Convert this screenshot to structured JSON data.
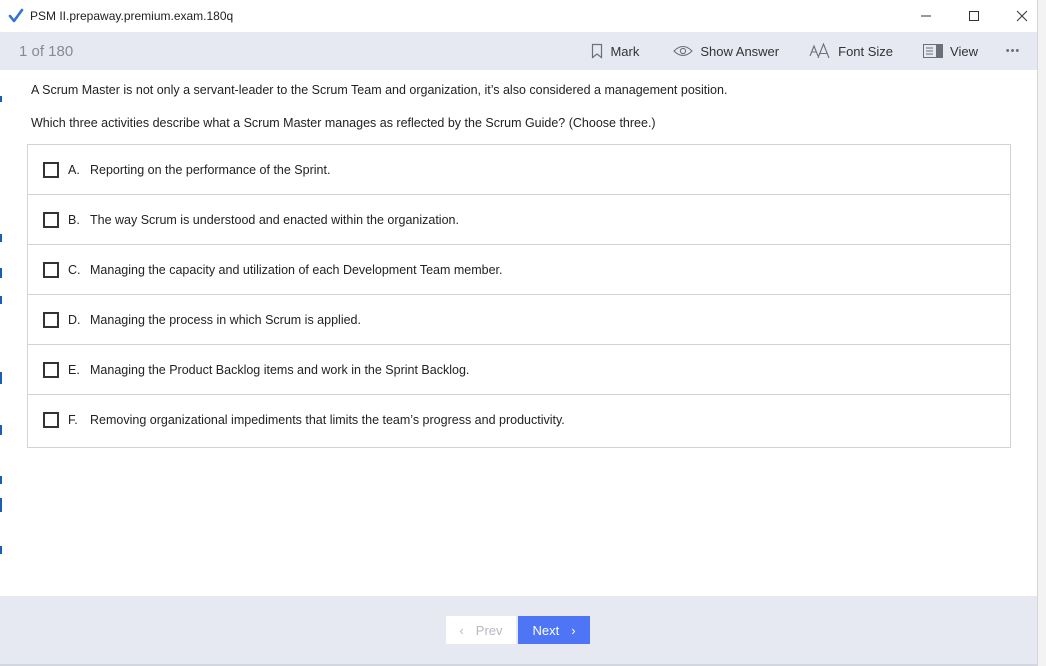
{
  "window": {
    "title": "PSM II.prepaway.premium.exam.180q",
    "controls": [
      "minimize-icon",
      "maximize-icon",
      "close-icon"
    ]
  },
  "toolbar": {
    "counter": "1 of 180",
    "mark_label": "Mark",
    "show_answer_label": "Show Answer",
    "font_size_label": "Font Size",
    "view_label": "View",
    "more_label": "•••"
  },
  "question": {
    "line1": "A Scrum Master is not only a servant-leader to the Scrum Team and organization, it’s also considered a management position.",
    "line2": "Which three activities describe what a Scrum Master manages as reflected by the Scrum Guide? (Choose three.)",
    "options": [
      {
        "letter": "A.",
        "text": "Reporting on the performance of the Sprint."
      },
      {
        "letter": "B.",
        "text": "The way Scrum is understood and enacted within the organization."
      },
      {
        "letter": "C.",
        "text": "Managing the capacity and utilization of each Development Team member."
      },
      {
        "letter": "D.",
        "text": "Managing the process in which Scrum is applied."
      },
      {
        "letter": "E.",
        "text": "Managing the Product Backlog items and work in the Sprint Backlog."
      },
      {
        "letter": "F.",
        "text": "Removing organizational impediments that limits the team’s progress and productivity."
      }
    ]
  },
  "footer": {
    "prev_label": "Prev",
    "next_label": "Next"
  },
  "colors": {
    "accent": "#4e75f6",
    "toolbar_bg": "#e6e9f2",
    "border": "#d0d3d9"
  }
}
